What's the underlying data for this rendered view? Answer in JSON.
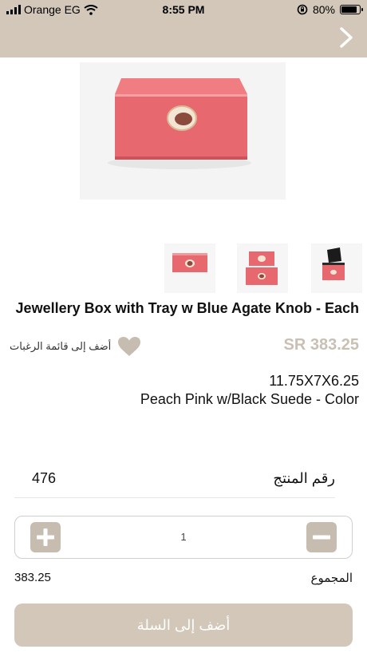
{
  "status_bar": {
    "carrier": "Orange EG",
    "time": "8:55 PM",
    "battery": "80%",
    "icons": [
      "signal-icon",
      "wifi-icon",
      "rotation-lock-icon",
      "battery-icon"
    ]
  },
  "header": {
    "back_icon": "chevron-right-icon",
    "color": "#d2c7b8"
  },
  "product": {
    "title": "Jewellery Box with Tray w Blue Agate Knob - Each",
    "price": "SR 383.25",
    "wishlist_label": "أضف إلى قائمة الرغبات",
    "wishlist_icon": "heart-icon",
    "dimensions": "11.75X7X6.25",
    "color_text": "Peach Pink w/Black Suede - Color",
    "product_number_label": "رقم المنتج",
    "product_number": "476",
    "quantity": "1",
    "total_label": "المجموع",
    "total_value": "383.25",
    "add_to_cart_label": "أضف إلى السلة",
    "accent_color": "#c7bcb0",
    "thumbnails": [
      "thumbnail-box-front",
      "thumbnail-box-stack",
      "thumbnail-box-open"
    ]
  }
}
